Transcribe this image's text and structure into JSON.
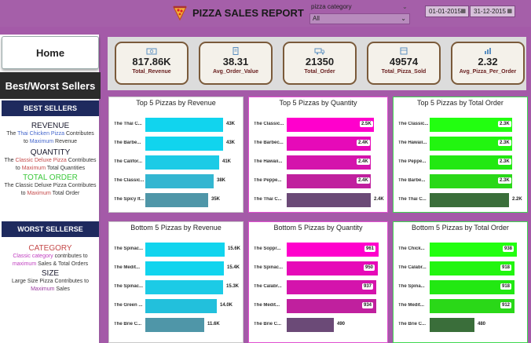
{
  "header": {
    "title": "PIZZA SALES REPORT",
    "category_label": "pizza category",
    "category_value": "All",
    "date_from": "01-01-2015",
    "date_to": "31-12-2015"
  },
  "sidebar": {
    "home": "Home",
    "best_worst": "Best/Worst Sellers",
    "best_sellers_head": "BEST SELLERS",
    "revenue_h": "REVENUE",
    "revenue_l1a": "The ",
    "revenue_l1b": "Thai Chicken Pizza",
    "revenue_l1c": " Contributes",
    "revenue_l2a": "to ",
    "revenue_l2b": "Maximum",
    "revenue_l2c": " Revenue",
    "quantity_h": "QUANTITY",
    "quantity_l1a": "The ",
    "quantity_l1b": "Classic Deluxe Pizza",
    "quantity_l1c": " Contributes",
    "quantity_l2a": "to ",
    "quantity_l2b": "Maximum",
    "quantity_l2c": " Total Quantities",
    "order_h": "TOTAL ORDER",
    "order_l1a": "The Classic Deluxe Pizza Contributes",
    "order_l2a": "to ",
    "order_l2b": "Maximum",
    "order_l2c": " Total Order",
    "worst_head": "WORST SELLERSE",
    "category_h": "CATEGORY",
    "category_l1a": "Classic category",
    "category_l1b": " contributes to",
    "category_l2a": "maximum",
    "category_l2b": " Sales & Total Orders",
    "size_h": "SIZE",
    "size_l1": "Large Size Pizza Contributes to",
    "size_l2": "Maximum",
    "size_l2b": " Sales"
  },
  "kpis": [
    {
      "value": "817.86K",
      "label": "Total_Revenue",
      "icon": "money-icon"
    },
    {
      "value": "38.31",
      "label": "Avg_Order_Value",
      "icon": "receipt-icon"
    },
    {
      "value": "21350",
      "label": "Total_Order",
      "icon": "delivery-icon"
    },
    {
      "value": "49574",
      "label": "Total_Pizza_Sold",
      "icon": "box-icon"
    },
    {
      "value": "2.32",
      "label": "Avg_Pizza_Per_Order",
      "icon": "chart-icon"
    }
  ],
  "chart_data": [
    {
      "type": "bar",
      "orientation": "horizontal",
      "title": "Top 5 Pizzas by Revenue",
      "categories": [
        "The Thai C...",
        "The Barbe...",
        "The Califor...",
        "The Classic...",
        "The Spicy It..."
      ],
      "values": [
        43,
        43,
        41,
        38,
        35
      ],
      "labels": [
        "43K",
        "43K",
        "41K",
        "38K",
        "35K"
      ],
      "colors": [
        "#11d4ee",
        "#11d4ee",
        "#1ccbe6",
        "#33b6d1",
        "#4f96a8"
      ],
      "xlim": [
        0,
        48
      ]
    },
    {
      "type": "bar",
      "orientation": "horizontal",
      "title": "Top 5 Pizzas by Quantity",
      "categories": [
        "The Classic...",
        "The Barbec...",
        "The Hawaii...",
        "The Peppe...",
        "The Thai C..."
      ],
      "values": [
        2.5,
        2.4,
        2.4,
        2.4,
        2.4
      ],
      "labels": [
        "2.5K",
        "2.4K",
        "2.4K",
        "2.4K",
        "2.4K"
      ],
      "colors": [
        "#ff00cc",
        "#e60ab8",
        "#d414ac",
        "#c0209e",
        "#6b4a77"
      ],
      "xlim": [
        0,
        2.7
      ]
    },
    {
      "type": "bar",
      "orientation": "horizontal",
      "title": "Top 5 Pizzas by Total Order",
      "categories": [
        "The Classic...",
        "The Hawaii...",
        "The Peppe...",
        "The Barbe...",
        "The Thai C..."
      ],
      "values": [
        2.3,
        2.3,
        2.3,
        2.3,
        2.2
      ],
      "labels": [
        "2.3K",
        "2.3K",
        "2.3K",
        "2.3K",
        "2.2K"
      ],
      "colors": [
        "#22ff10",
        "#22f510",
        "#22e812",
        "#2ad818",
        "#3a6e3a"
      ],
      "xlim": [
        0,
        2.45
      ]
    },
    {
      "type": "bar",
      "orientation": "horizontal",
      "title": "Bottom 5 Pizzas by Revenue",
      "categories": [
        "The Spinac...",
        "The Medit...",
        "The Spinac...",
        "The Green ...",
        "The Brie C..."
      ],
      "values": [
        15.6,
        15.4,
        15.3,
        14.0,
        11.6
      ],
      "labels": [
        "15.6K",
        "15.4K",
        "15.3K",
        "14.0K",
        "11.6K"
      ],
      "colors": [
        "#11d4ee",
        "#11d4ee",
        "#1ccbe6",
        "#22c0dc",
        "#4f96a8"
      ],
      "xlim": [
        0,
        17
      ]
    },
    {
      "type": "bar",
      "orientation": "horizontal",
      "title": "Bottom 5 Pizzas by Quantity",
      "categories": [
        "The Soppr...",
        "The Spinac...",
        "The Calabr...",
        "The Medit...",
        "The Brie C..."
      ],
      "values": [
        961,
        950,
        937,
        934,
        490
      ],
      "labels": [
        "961",
        "950",
        "937",
        "934",
        "490"
      ],
      "colors": [
        "#ff00cc",
        "#e60ab8",
        "#d414ac",
        "#c0209e",
        "#6b4a77"
      ],
      "xlim": [
        0,
        1000
      ]
    },
    {
      "type": "bar",
      "orientation": "horizontal",
      "title": "Bottom 5 Pizzas by Total Order",
      "categories": [
        "The Chick...",
        "The Calabr...",
        "The Spina...",
        "The Medit...",
        "The Brie C..."
      ],
      "values": [
        938,
        918,
        918,
        912,
        480
      ],
      "labels": [
        "938",
        "918",
        "918",
        "912",
        "480"
      ],
      "colors": [
        "#22ff10",
        "#22f510",
        "#22e812",
        "#2ad818",
        "#3a6e3a"
      ],
      "xlim": [
        0,
        1000
      ]
    }
  ]
}
